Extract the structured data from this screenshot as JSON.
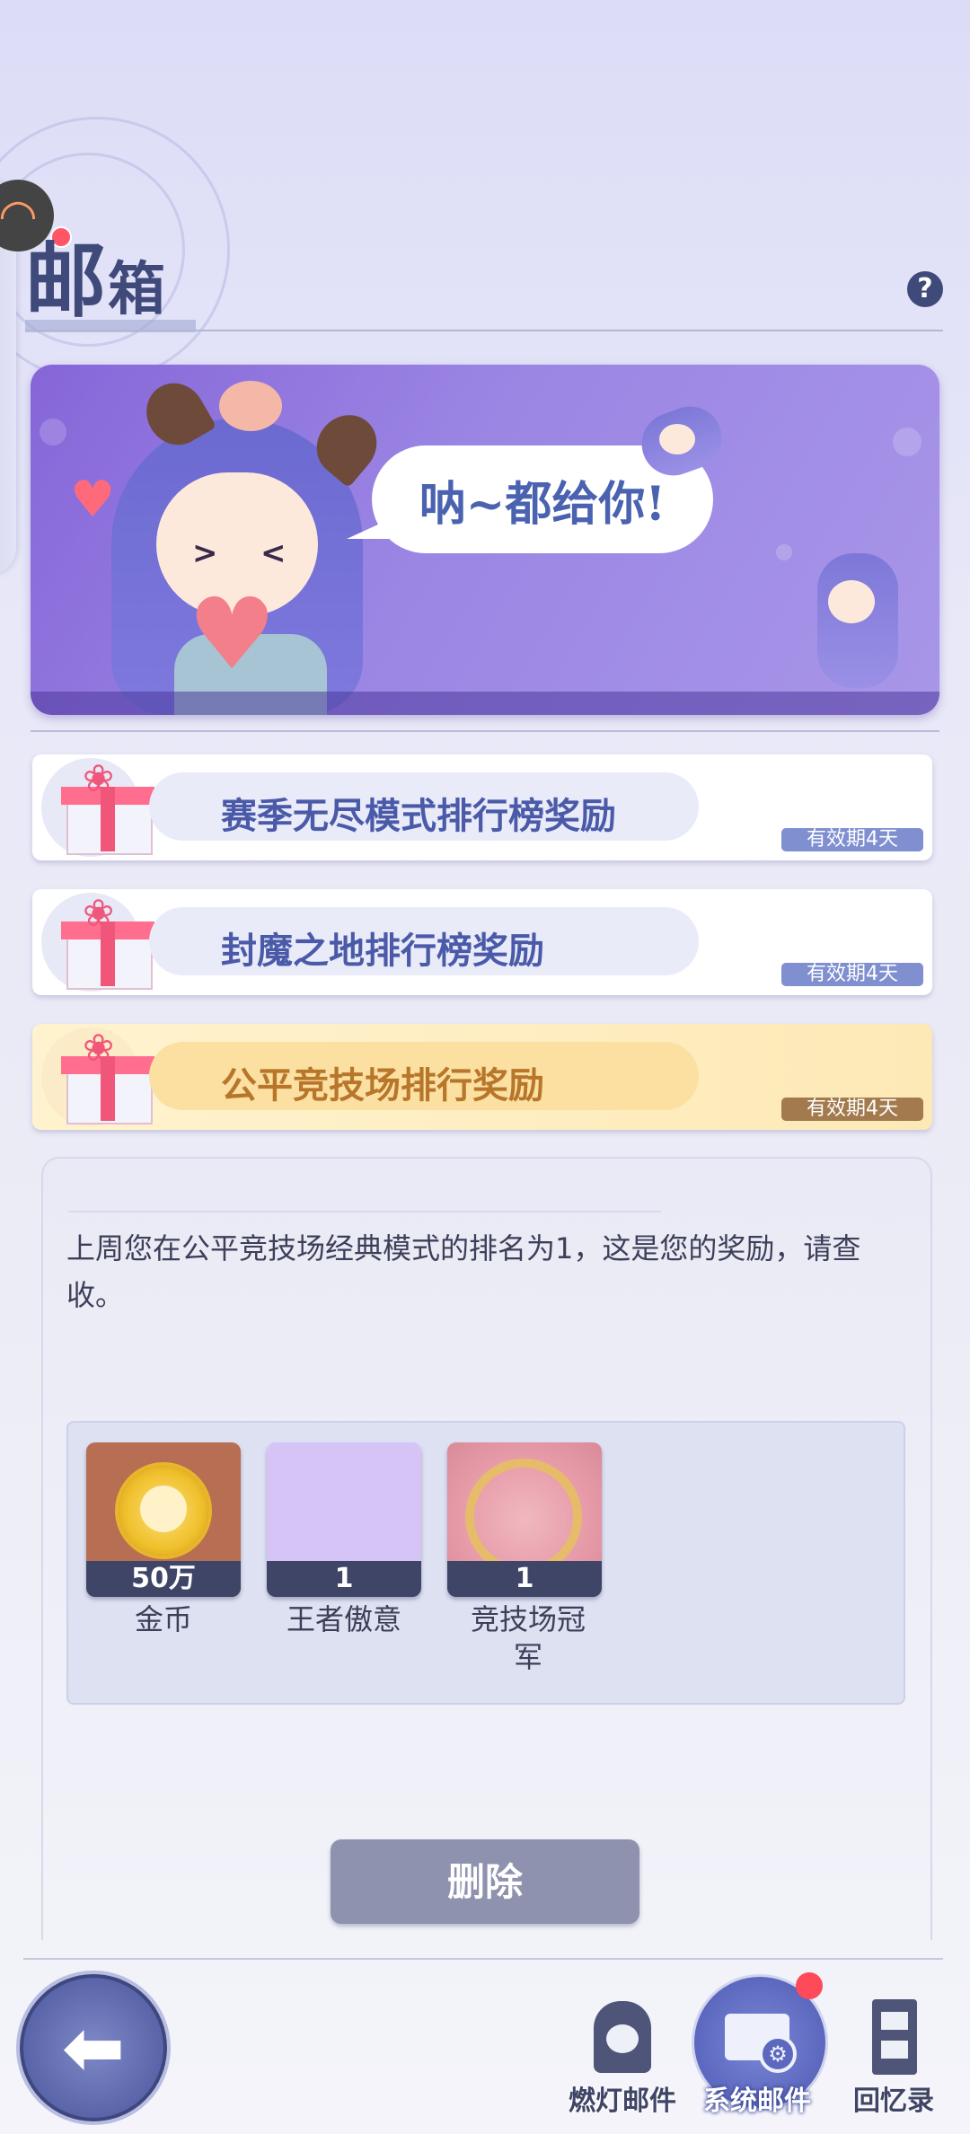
{
  "header": {
    "title_big": "邮",
    "title_small": "箱",
    "help_label": "?"
  },
  "banner": {
    "speech": "呐~都给你!"
  },
  "mails": [
    {
      "title": "赛季无尽模式排行榜奖励",
      "expiry": "有效期4天",
      "variant": "normal"
    },
    {
      "title": "封魔之地排行榜奖励",
      "expiry": "有效期4天",
      "variant": "normal"
    },
    {
      "title": "公平竞技场排行奖励",
      "expiry": "有效期4天",
      "variant": "selected"
    }
  ],
  "detail": {
    "message": "上周您在公平竞技场经典模式的排名为1，这是您的奖励，请查收。",
    "rewards": [
      {
        "count": "50万",
        "name": "金币",
        "icon": "gold-coin-icon",
        "bg": "#b86e52"
      },
      {
        "count": "1",
        "name": "王者傲意",
        "icon": "blank-item-icon",
        "bg": "#d6c4f7"
      },
      {
        "count": "1",
        "name": "竞技场冠军",
        "icon": "champion-frame-icon",
        "bg": "#e6a4a4"
      }
    ],
    "delete_label": "删除"
  },
  "bottom_nav": {
    "back_label": "",
    "items": [
      {
        "label": "燃灯邮件",
        "icon": "lantern-mail-icon"
      },
      {
        "label": "系统邮件",
        "icon": "system-mail-icon",
        "active": true
      },
      {
        "label": "回忆录",
        "icon": "film-strip-icon"
      }
    ]
  },
  "colors": {
    "accent": "#4a5aa8",
    "gold_text": "#b8762a",
    "badge_red": "#ff4a5a"
  }
}
